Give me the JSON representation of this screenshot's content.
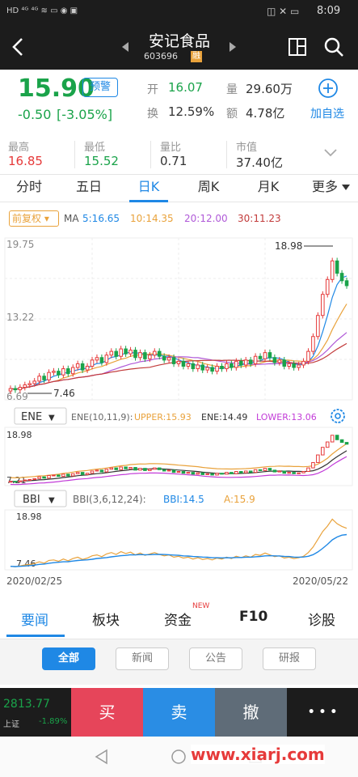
{
  "status_bar": {
    "left_icons": [
      "HD",
      "4G",
      "4G",
      "wifi",
      "app",
      "app",
      "app"
    ],
    "time": "8:09"
  },
  "header": {
    "title": "安记食品",
    "code": "603696",
    "badge": "融"
  },
  "quote": {
    "price": "15.90",
    "alert_label": "预警",
    "change": "-0.50",
    "change_pct": "[-3.05%]",
    "open_label": "开",
    "open_value": "16.07",
    "turnover_label": "换",
    "turnover_value": "12.59%",
    "volume_label": "量",
    "volume_value": "29.60万",
    "amount_label": "额",
    "amount_value": "4.78亿",
    "add_label": "加自选"
  },
  "stats": [
    {
      "label": "最高",
      "value": "16.85"
    },
    {
      "label": "最低",
      "value": "15.52"
    },
    {
      "label": "量比",
      "value": "0.71"
    },
    {
      "label": "市值",
      "value": "37.40亿"
    }
  ],
  "tabs": [
    "分时",
    "五日",
    "日K",
    "周K",
    "月K",
    "更多"
  ],
  "ma_bar": {
    "adjust": "前复权",
    "label": "MA",
    "ma5": "5:16.65",
    "ma10": "10:14.35",
    "ma20": "20:12.00",
    "ma30": "30:11.23"
  },
  "main_chart": {
    "max_label": "19.75",
    "mid_label": "13.22",
    "min_label": "6.69",
    "high_mark": "18.98",
    "low_mark": "7.46"
  },
  "ene_bar": {
    "name": "ENE",
    "params": "ENE(10,11,9):",
    "upper": "UPPER:15.93",
    "ene": "ENE:14.49",
    "lower": "LOWER:13.06"
  },
  "ene_chart": {
    "max_label": "18.98",
    "min_label": "7.21"
  },
  "bbi_bar": {
    "name": "BBI",
    "params": "BBI(3,6,12,24):",
    "bbi": "BBI:14.5",
    "a": "A:15.9"
  },
  "bbi_chart": {
    "max_label": "18.98",
    "min_label": "7.46"
  },
  "date_axis": {
    "start": "2020/02/25",
    "end": "2020/05/22"
  },
  "news_tabs": [
    {
      "label": "要闻",
      "active": true
    },
    {
      "label": "板块"
    },
    {
      "label": "资金",
      "badge": "NEW"
    },
    {
      "label": "F10"
    },
    {
      "label": "诊股"
    }
  ],
  "filters": [
    "全部",
    "新闻",
    "公告",
    "研报"
  ],
  "index": {
    "value": "2813.77",
    "name": "上证",
    "change": "-1.89%"
  },
  "actions": {
    "buy": "买",
    "sell": "卖",
    "cancel": "撤",
    "more": "• • •"
  },
  "watermark": "www.xiarj.com",
  "colors": {
    "red": "#e63a3a",
    "green": "#1aa34a",
    "blue": "#1f88e5",
    "dark": "#1c1c1c"
  },
  "chart_data": {
    "type": "candlestick",
    "x_start": "2020/02/25",
    "x_end": "2020/05/22",
    "ylim": [
      6.69,
      19.75
    ],
    "high": 18.98,
    "low": 7.46,
    "close": [
      7.6,
      7.5,
      7.7,
      7.9,
      8.0,
      8.2,
      8.6,
      8.3,
      8.9,
      9.0,
      8.7,
      9.2,
      8.8,
      9.3,
      9.6,
      9.1,
      9.4,
      9.9,
      10.1,
      9.7,
      10.3,
      10.6,
      10.2,
      10.8,
      10.4,
      10.7,
      10.1,
      10.5,
      10.0,
      10.3,
      10.6,
      10.2,
      9.9,
      10.1,
      9.6,
      9.8,
      9.4,
      9.6,
      9.2,
      9.5,
      9.1,
      9.3,
      9.0,
      9.4,
      9.2,
      9.6,
      9.3,
      9.8,
      9.5,
      9.9,
      9.6,
      10.2,
      10.0,
      10.5,
      10.1,
      9.7,
      9.9,
      9.4,
      9.6,
      9.3,
      9.5,
      9.8,
      10.6,
      11.8,
      13.5,
      15.2,
      16.4,
      17.9,
      16.9,
      16.3,
      15.9
    ]
  }
}
